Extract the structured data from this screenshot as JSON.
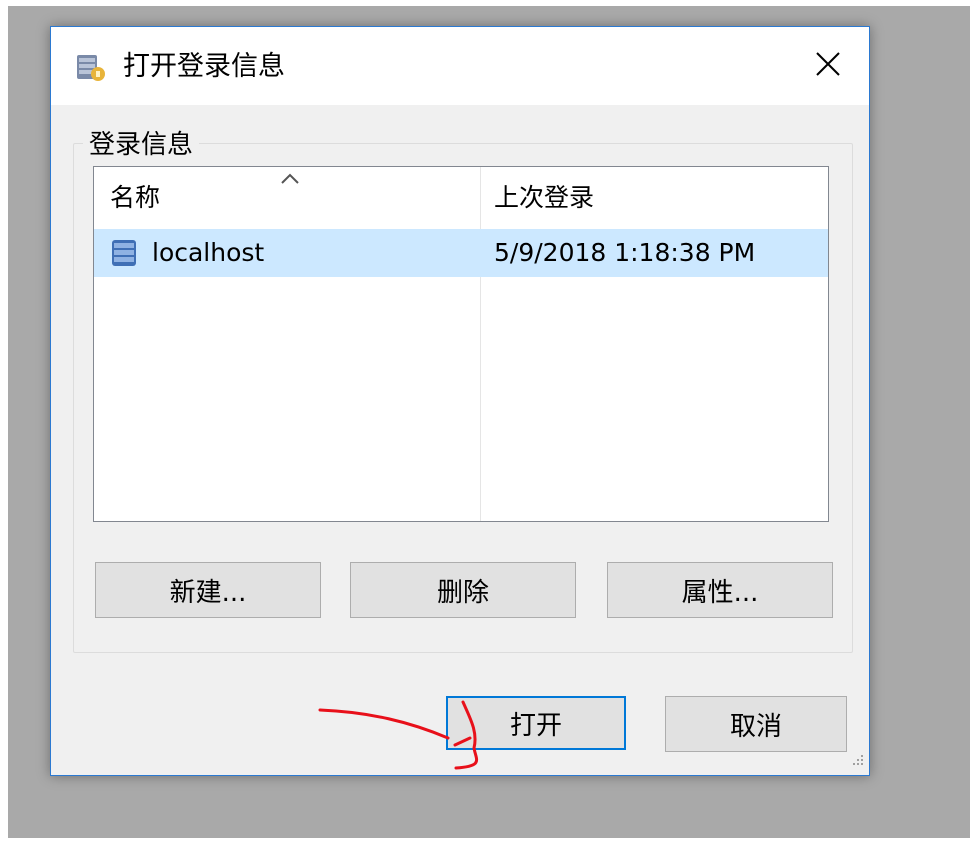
{
  "dialog": {
    "title": "打开登录信息",
    "close_icon": "close-icon",
    "app_icon": "database-login-icon"
  },
  "group": {
    "label": "登录信息"
  },
  "list": {
    "columns": [
      "名称",
      "上次登录"
    ],
    "sorted_column": "名称",
    "rows": [
      {
        "name": "localhost",
        "last_login": "5/9/2018 1:18:38 PM",
        "icon": "database-icon",
        "selected": true
      }
    ]
  },
  "buttons": {
    "new": "新建...",
    "delete": "删除",
    "properties": "属性...",
    "open": "打开",
    "cancel": "取消"
  },
  "colors": {
    "accent": "#0078d7",
    "selection": "#cce8ff",
    "annotation": "#e8101a"
  }
}
